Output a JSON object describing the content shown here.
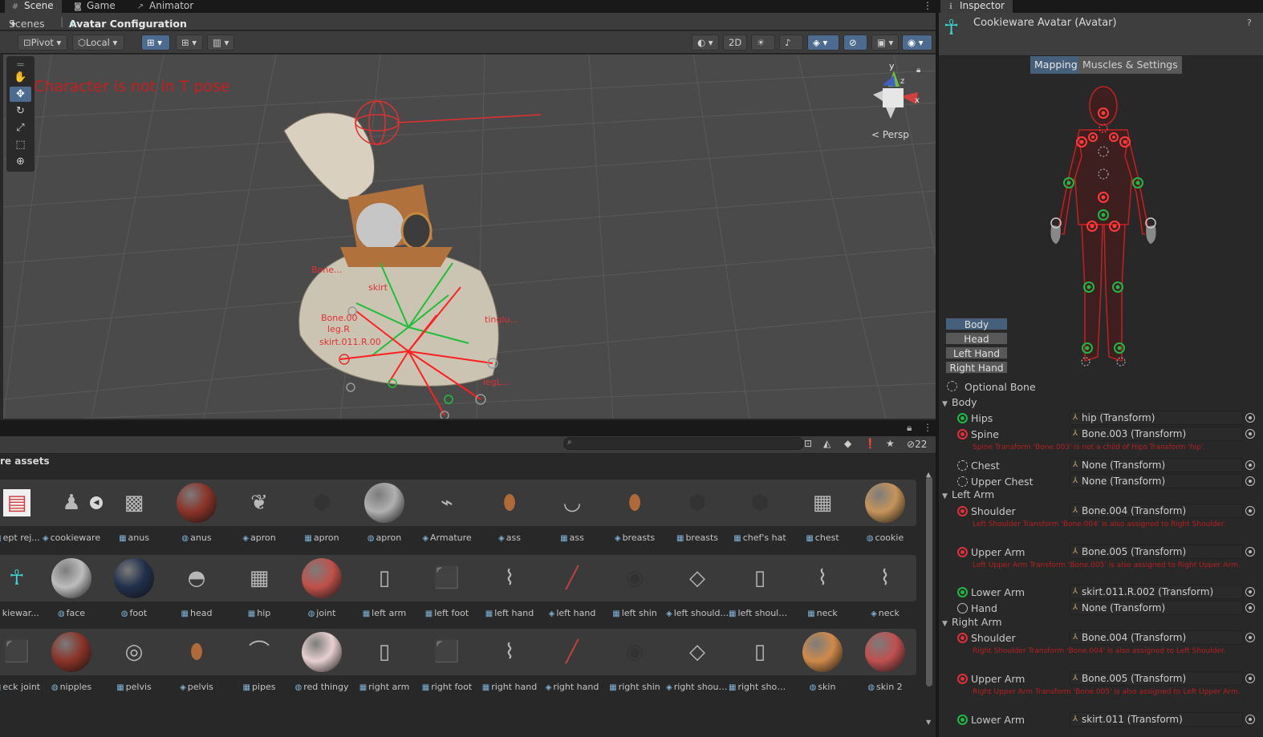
{
  "scene_tabs": [
    {
      "label": "Scene",
      "icon": "grid-icon"
    },
    {
      "label": "Game",
      "icon": "gamepad-icon"
    },
    {
      "label": "Animator",
      "icon": "animator-icon"
    }
  ],
  "breadcrumb": {
    "root": "Scenes",
    "current": "Avatar Configuration"
  },
  "toolbar": {
    "pivot": "Pivot",
    "local": "Local",
    "mode_2d": "2D"
  },
  "viewport": {
    "warning": "Character is not in T pose",
    "projection": "< Persp",
    "gizmo_axes": {
      "y": "y",
      "z": "z",
      "x": "x"
    },
    "bone_labels": [
      "Bone.00",
      "leg.R",
      "skirt.011.R.00",
      "skirt",
      "tinglu...",
      "legL...",
      "Bone..."
    ]
  },
  "project": {
    "breadcrumb": "re assets",
    "hidden_count": "22",
    "rows": [
      [
        {
          "label": "ept rej...",
          "icon": "texture-icon"
        },
        {
          "label": "cookieware",
          "icon": "prefab-icon"
        },
        {
          "label": "anus",
          "icon": "mesh-icon"
        },
        {
          "label": "anus",
          "icon": "material-icon"
        },
        {
          "label": "apron",
          "icon": "prefab-icon"
        },
        {
          "label": "apron",
          "icon": "mesh-icon"
        },
        {
          "label": "apron",
          "icon": "material-icon"
        },
        {
          "label": "Armature",
          "icon": "prefab-icon"
        },
        {
          "label": "ass",
          "icon": "prefab-icon"
        },
        {
          "label": "ass",
          "icon": "mesh-icon"
        },
        {
          "label": "breasts",
          "icon": "prefab-icon"
        },
        {
          "label": "breasts",
          "icon": "mesh-icon"
        },
        {
          "label": "chef's hat",
          "icon": "mesh-icon"
        },
        {
          "label": "chest",
          "icon": "mesh-icon"
        },
        {
          "label": "cookie",
          "icon": "material-icon"
        }
      ],
      [
        {
          "label": "kiewar...",
          "icon": "avatar-icon"
        },
        {
          "label": "face",
          "icon": "material-icon"
        },
        {
          "label": "foot",
          "icon": "material-icon"
        },
        {
          "label": "head",
          "icon": "mesh-icon"
        },
        {
          "label": "hip",
          "icon": "mesh-icon"
        },
        {
          "label": "joint",
          "icon": "material-icon"
        },
        {
          "label": "left arm",
          "icon": "mesh-icon"
        },
        {
          "label": "left foot",
          "icon": "mesh-icon"
        },
        {
          "label": "left hand",
          "icon": "mesh-icon"
        },
        {
          "label": "left hand",
          "icon": "prefab-icon"
        },
        {
          "label": "left shin",
          "icon": "mesh-icon"
        },
        {
          "label": "left should...",
          "icon": "prefab-icon"
        },
        {
          "label": "left should...",
          "icon": "mesh-icon"
        },
        {
          "label": "neck",
          "icon": "mesh-icon"
        },
        {
          "label": "neck",
          "icon": "prefab-icon"
        }
      ],
      [
        {
          "label": "eck joint",
          "icon": "mesh-icon"
        },
        {
          "label": "nipples",
          "icon": "material-icon"
        },
        {
          "label": "pelvis",
          "icon": "mesh-icon"
        },
        {
          "label": "pelvis",
          "icon": "prefab-icon"
        },
        {
          "label": "pipes",
          "icon": "mesh-icon"
        },
        {
          "label": "red thingy",
          "icon": "material-icon"
        },
        {
          "label": "right arm",
          "icon": "mesh-icon"
        },
        {
          "label": "right foot",
          "icon": "mesh-icon"
        },
        {
          "label": "right hand",
          "icon": "mesh-icon"
        },
        {
          "label": "right hand",
          "icon": "prefab-icon"
        },
        {
          "label": "right shin",
          "icon": "mesh-icon"
        },
        {
          "label": "right shoul...",
          "icon": "prefab-icon"
        },
        {
          "label": "right shoul...",
          "icon": "mesh-icon"
        },
        {
          "label": "skin",
          "icon": "material-icon"
        },
        {
          "label": "skin 2",
          "icon": "material-icon"
        }
      ]
    ]
  },
  "inspector": {
    "tab": "Inspector",
    "title": "Cookieware Avatar (Avatar)",
    "tabs": [
      "Mapping",
      "Muscles & Settings"
    ],
    "body_parts": [
      "Body",
      "Head",
      "Left Hand",
      "Right Hand"
    ],
    "optional_bone": "Optional Bone",
    "groups": {
      "body": "Body",
      "left_arm": "Left Arm",
      "right_arm": "Right Arm"
    },
    "bones": [
      {
        "name": "Hips",
        "value": "hip (Transform)",
        "status": "green"
      },
      {
        "name": "Spine",
        "value": "Bone.003 (Transform)",
        "status": "red",
        "error": "Spine Transform 'Bone.003' is not a child of Hips Transform 'hip'."
      },
      {
        "name": "Chest",
        "value": "None (Transform)",
        "status": "dashed"
      },
      {
        "name": "Upper Chest",
        "value": "None (Transform)",
        "status": "dashed"
      },
      {
        "name": "Shoulder",
        "value": "Bone.004 (Transform)",
        "status": "red",
        "error": "Left Shoulder Transform 'Bone.004' is also assigned to Right Shoulder."
      },
      {
        "name": "Upper Arm",
        "value": "Bone.005 (Transform)",
        "status": "red",
        "error": "Left Upper Arm Transform 'Bone.005' is also assigned to Right Upper Arm."
      },
      {
        "name": "Lower Arm",
        "value": "skirt.011.R.002 (Transform)",
        "status": "green"
      },
      {
        "name": "Hand",
        "value": "None (Transform)",
        "status": "empty"
      },
      {
        "name": "Shoulder",
        "value": "Bone.004 (Transform)",
        "status": "red",
        "error": "Right Shoulder Transform 'Bone.004' is also assigned to Left Shoulder."
      },
      {
        "name": "Upper Arm",
        "value": "Bone.005 (Transform)",
        "status": "red",
        "error": "Right Upper Arm Transform 'Bone.005' is also assigned to Left Upper Arm."
      },
      {
        "name": "Lower Arm",
        "value": "skirt.011 (Transform)",
        "status": "green"
      }
    ]
  },
  "colors": {
    "accent": "#4c6b8f",
    "error": "#c81e1e",
    "ok": "#1fb846",
    "avatar_cyan": "#3fd2d2"
  }
}
